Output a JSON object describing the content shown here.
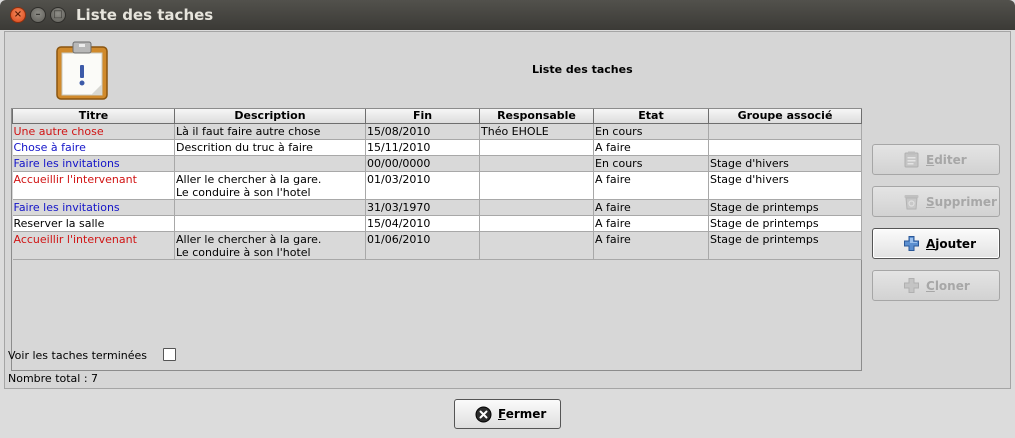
{
  "window": {
    "title": "Liste des taches"
  },
  "header": {
    "heading": "Liste des taches",
    "icon": "clipboard-alert-icon"
  },
  "table": {
    "columns": [
      "Titre",
      "Description",
      "Fin",
      "Responsable",
      "Etat",
      "Groupe associé"
    ],
    "rows": [
      {
        "titre": "Une autre chose",
        "titre_color": "#d01414",
        "description": [
          "Là il faut faire autre chose"
        ],
        "fin": "15/08/2010",
        "responsable": "Théo EHOLE",
        "etat": "En cours",
        "groupe": ""
      },
      {
        "titre": "Chose à faire",
        "titre_color": "#1414c8",
        "description": [
          "Descrition du truc à faire"
        ],
        "fin": "15/11/2010",
        "responsable": "",
        "etat": "A faire",
        "groupe": ""
      },
      {
        "titre": "Faire les invitations",
        "titre_color": "#1414c8",
        "description": [
          ""
        ],
        "fin": "00/00/0000",
        "responsable": "",
        "etat": "En cours",
        "groupe": "Stage d'hivers"
      },
      {
        "titre": "Accueillir l'intervenant",
        "titre_color": "#d01414",
        "description": [
          "Aller le chercher à la gare.",
          "Le conduire à son l'hotel"
        ],
        "fin": "01/03/2010",
        "responsable": "",
        "etat": "A faire",
        "groupe": "Stage d'hivers"
      },
      {
        "titre": "Faire les invitations",
        "titre_color": "#1414c8",
        "description": [
          ""
        ],
        "fin": "31/03/1970",
        "responsable": "",
        "etat": "A faire",
        "groupe": "Stage de printemps"
      },
      {
        "titre": "Reserver la salle",
        "titre_color": "#000000",
        "description": [
          ""
        ],
        "fin": "15/04/2010",
        "responsable": "",
        "etat": "A faire",
        "groupe": "Stage de printemps"
      },
      {
        "titre": "Accueillir l'intervenant",
        "titre_color": "#d01414",
        "description": [
          "Aller le chercher à la gare.",
          "Le conduire à son l'hotel"
        ],
        "fin": "01/06/2010",
        "responsable": "",
        "etat": "A faire",
        "groupe": "Stage de printemps"
      }
    ]
  },
  "actions": {
    "editer": {
      "label": "Editer",
      "enabled": false,
      "icon": "clipboard-icon"
    },
    "supprimer": {
      "label": "Supprimer",
      "enabled": false,
      "icon": "trash-icon"
    },
    "ajouter": {
      "label": "Ajouter",
      "enabled": true,
      "icon": "plus-icon"
    },
    "cloner": {
      "label": "Cloner",
      "enabled": false,
      "icon": "plus-icon"
    }
  },
  "filters": {
    "show_finished_label": "Voir les taches terminées",
    "show_finished_checked": false
  },
  "footer": {
    "total_label": "Nombre total : 7",
    "close_label": "Fermer",
    "close_icon": "close-circle-icon"
  },
  "colors": {
    "title_red": "#d01414",
    "title_blue": "#1414c8",
    "titlebar": "#3b3a36"
  }
}
